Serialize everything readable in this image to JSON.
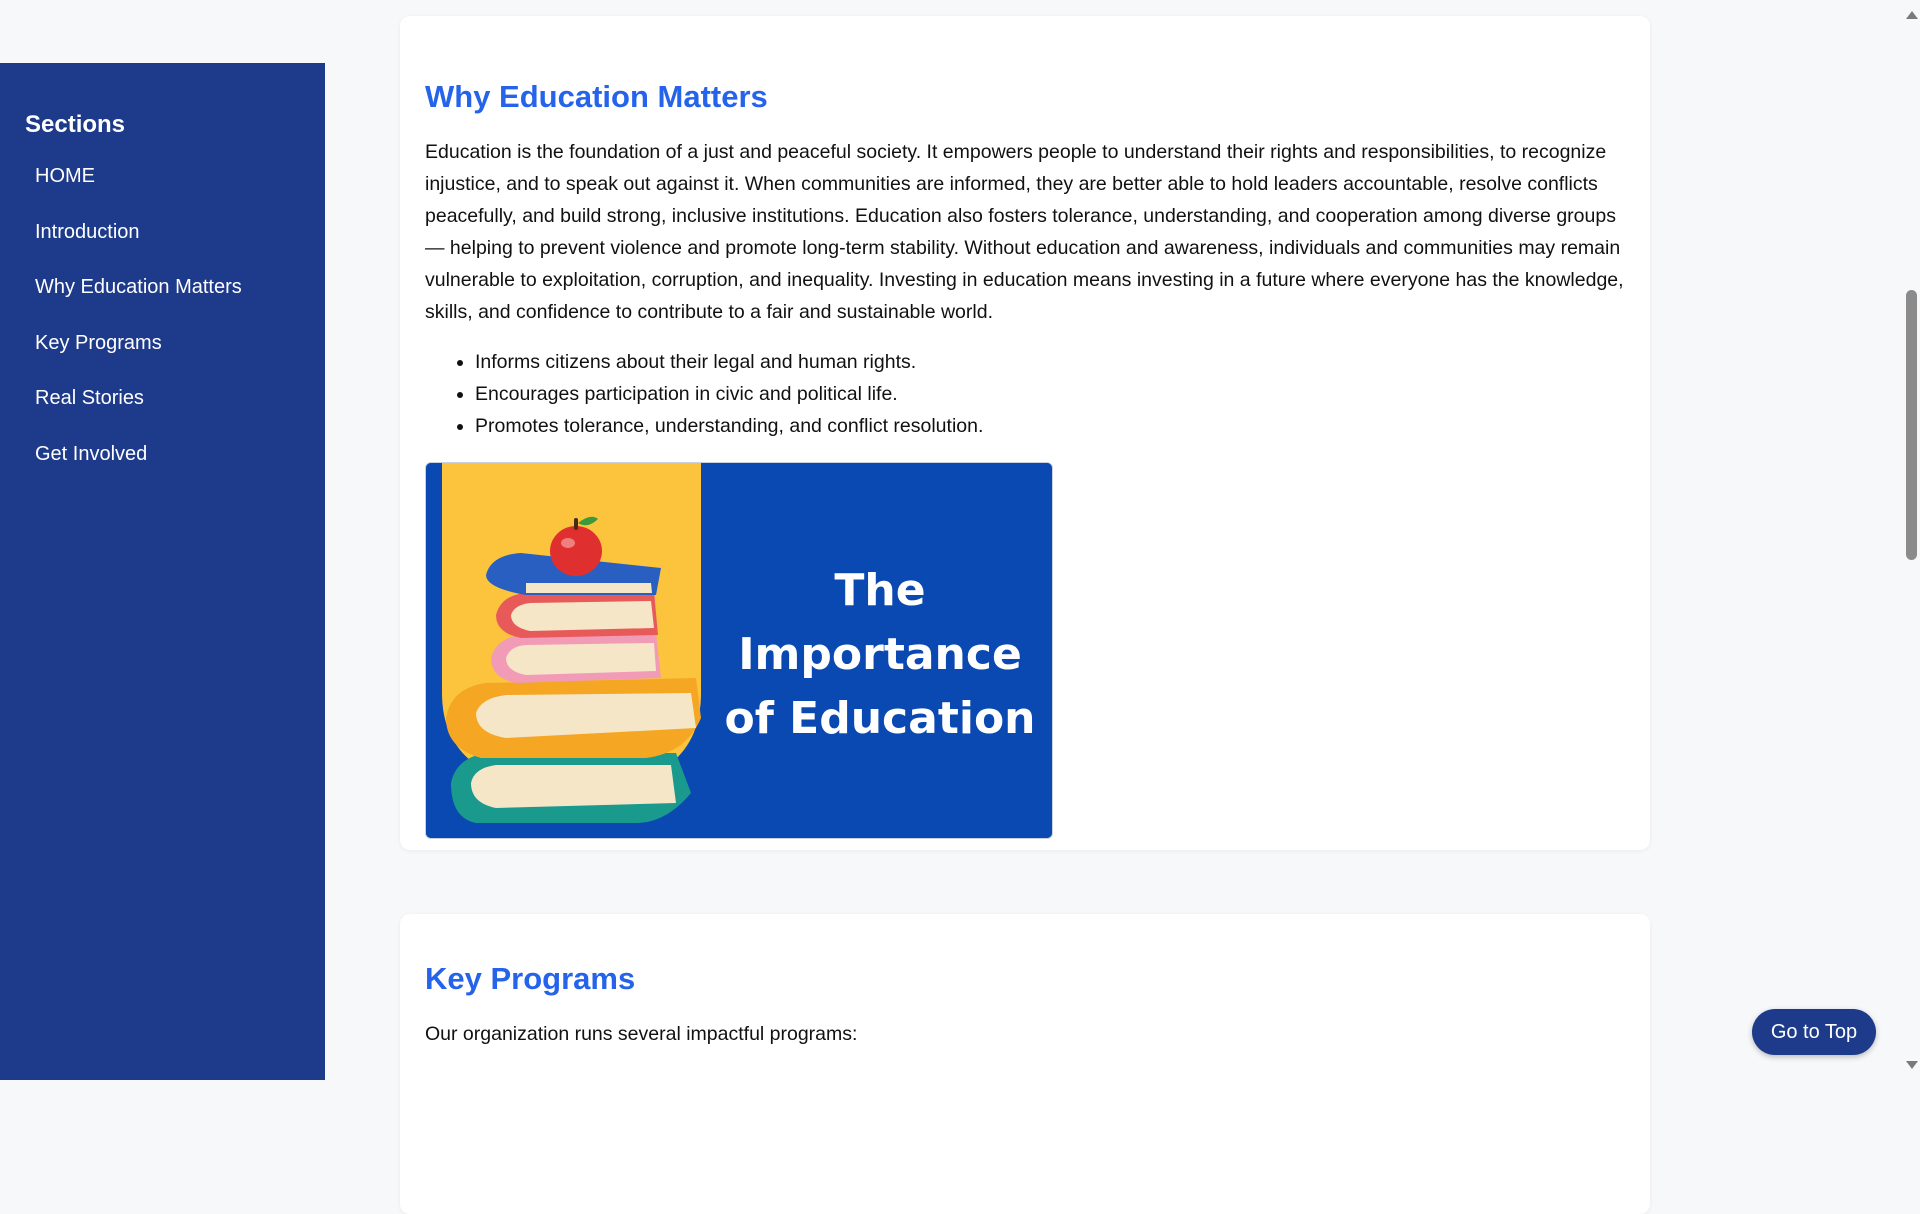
{
  "sidebar": {
    "title": "Sections",
    "items": [
      {
        "label": "HOME"
      },
      {
        "label": "Introduction"
      },
      {
        "label": "Why Education Matters"
      },
      {
        "label": "Key Programs"
      },
      {
        "label": "Real Stories"
      },
      {
        "label": "Get Involved"
      }
    ]
  },
  "section_why": {
    "heading": "Why Education Matters",
    "paragraph": "Education is the foundation of a just and peaceful society. It empowers people to understand their rights and responsibilities, to recognize injustice, and to speak out against it. When communities are informed, they are better able to hold leaders accountable, resolve conflicts peacefully, and build strong, inclusive institutions. Education also fosters tolerance, understanding, and cooperation among diverse groups — helping to prevent violence and promote long-term stability. Without education and awareness, individuals and communities may remain vulnerable to exploitation, corruption, and inequality. Investing in education means investing in a future where everyone has the knowledge, skills, and confidence to contribute to a fair and sustainable world.",
    "bullets": [
      "Informs citizens about their legal and human rights.",
      "Encourages participation in civic and political life.",
      "Promotes tolerance, understanding, and conflict resolution."
    ],
    "image": {
      "caption_line1": "The Importance",
      "caption_line2": "of Education",
      "background_color": "#0a49b2",
      "accent_color": "#fbc43c"
    }
  },
  "section_programs": {
    "heading": "Key Programs",
    "intro": "Our organization runs several impactful programs:"
  },
  "go_to_top": {
    "label": "Go to Top"
  },
  "colors": {
    "sidebar_bg": "#1e3a8a",
    "heading": "#2563eb",
    "page_bg": "#f7f8fa"
  }
}
